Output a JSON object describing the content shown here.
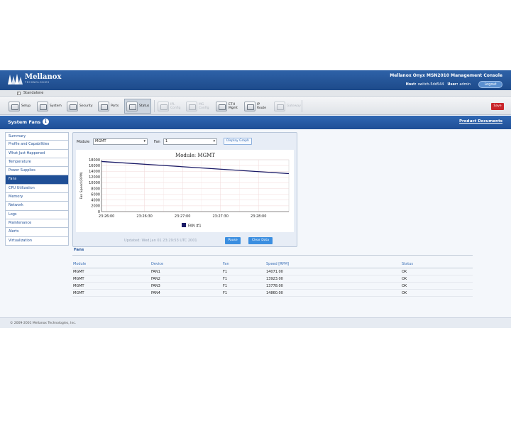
{
  "header": {
    "logo_name": "Mellanox",
    "logo_sub": "TECHNOLOGIES",
    "console_title": "Mellanox Onyx MSN2010 Management Console",
    "host_label": "Host:",
    "host_value": "switch-5dd544",
    "user_label": "User:",
    "user_value": "admin",
    "logout_label": "Logout"
  },
  "modebar": {
    "indicator": "?",
    "mode": "Standalone"
  },
  "toolbar": {
    "tabs": [
      {
        "label": "Setup",
        "icon": "setup-icon",
        "state": "normal"
      },
      {
        "label": "System",
        "icon": "system-icon",
        "state": "normal"
      },
      {
        "label": "Security",
        "icon": "security-icon",
        "state": "normal"
      },
      {
        "label": "Ports",
        "icon": "ports-icon",
        "state": "normal"
      },
      {
        "label": "Status",
        "icon": "status-icon",
        "state": "active"
      },
      {
        "label": "IPL\nConfig",
        "icon": "ipl-config-icon",
        "state": "disabled"
      },
      {
        "label": "MG\nConfig",
        "icon": "mg-config-icon",
        "state": "disabled"
      },
      {
        "label": "ETH\nMgmt",
        "icon": "eth-mgmt-icon",
        "state": "normal"
      },
      {
        "label": "IP\nRoute",
        "icon": "ip-route-icon",
        "state": "normal"
      },
      {
        "label": "Gateway",
        "icon": "gateway-icon",
        "state": "disabled"
      }
    ],
    "save_label": "Save"
  },
  "titlebar": {
    "title": "System Fans",
    "info": "i",
    "product_docs": "Product Documents"
  },
  "sidebar": {
    "items": [
      {
        "label": "Summary",
        "active": false
      },
      {
        "label": "Profile and Capabilities",
        "active": false
      },
      {
        "label": "What Just Happened",
        "active": false
      },
      {
        "label": "Temperature",
        "active": false
      },
      {
        "label": "Power Supplies",
        "active": false
      },
      {
        "label": "Fans",
        "active": true
      },
      {
        "label": "CPU Utilization",
        "active": false
      },
      {
        "label": "Memory",
        "active": false
      },
      {
        "label": "Network",
        "active": false
      },
      {
        "label": "Logs",
        "active": false
      },
      {
        "label": "Maintenance",
        "active": false
      },
      {
        "label": "Alerts",
        "active": false
      },
      {
        "label": "Virtualization",
        "active": false
      }
    ]
  },
  "graph_controls": {
    "module_label": "Module",
    "module_value": "MGMT",
    "fan_label": "Fan",
    "fan_value": "1",
    "display_graph_label": "Display Graph",
    "updated_text": "Updated: Wed Jan 01 23:29:53 UTC 2001",
    "pause_label": "Pause",
    "clear_label": "Clear Data"
  },
  "chart_data": {
    "type": "line",
    "title": "Module: MGMT",
    "ylabel": "Fan Speed (RPM)",
    "xlabel": "",
    "ylim": [
      0,
      18000
    ],
    "yticks": [
      0,
      2000,
      4000,
      6000,
      8000,
      10000,
      12000,
      14000,
      16000,
      18000
    ],
    "xticks": [
      "23:26:00",
      "23:26:30",
      "23:27:00",
      "23:27:30",
      "23:28:00"
    ],
    "xticks_sec": [
      0,
      30,
      60,
      90,
      120
    ],
    "xlim_sec": [
      -4,
      144
    ],
    "grid": true,
    "legend_position": "bottom",
    "line_color": "#1a1a66",
    "series": [
      {
        "name": "FAN #1",
        "x_sec": [
          -4,
          144
        ],
        "values": [
          17400,
          13200
        ]
      }
    ]
  },
  "fans_table": {
    "heading": "Fans",
    "columns": [
      "Module",
      "Device",
      "Fan",
      "Speed [RPM]",
      "Status"
    ],
    "rows": [
      [
        "MGMT",
        "FAN1",
        "F1",
        "14071.00",
        "OK"
      ],
      [
        "MGMT",
        "FAN2",
        "F1",
        "13923.00",
        "OK"
      ],
      [
        "MGMT",
        "FAN3",
        "F1",
        "13778.00",
        "OK"
      ],
      [
        "MGMT",
        "FAN4",
        "F1",
        "14860.00",
        "OK"
      ]
    ]
  },
  "footer": {
    "copyright": "© 2009-2001 Mellanox Technologies, Inc."
  }
}
